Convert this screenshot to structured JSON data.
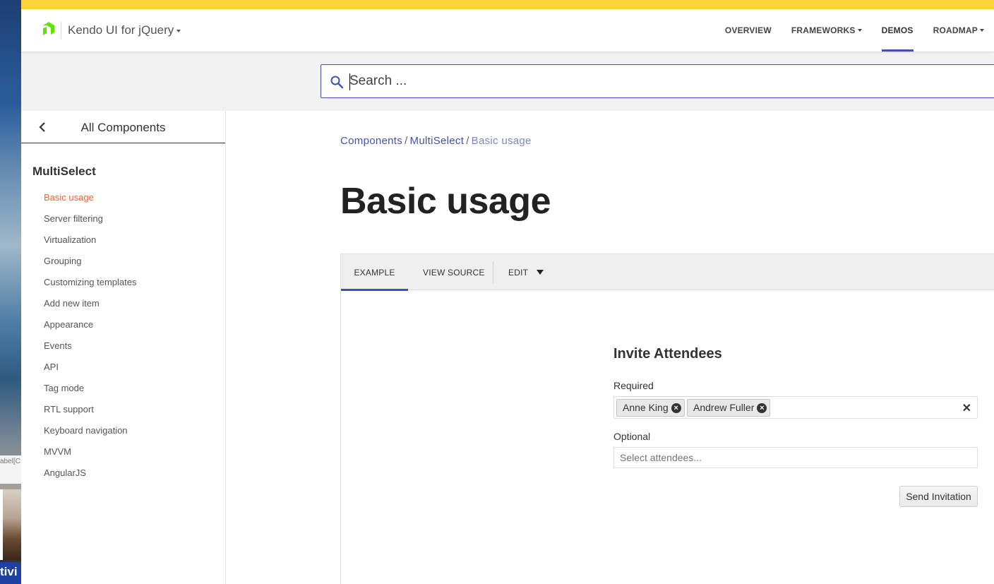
{
  "background": {
    "label_fragment": "abel[C",
    "activity_fragment": "tivi"
  },
  "header": {
    "product": "Kendo UI for jQuery",
    "nav": [
      {
        "label": "OVERVIEW"
      },
      {
        "label": "FRAMEWORKS"
      },
      {
        "label": "DEMOS"
      },
      {
        "label": "ROADMAP"
      }
    ]
  },
  "search": {
    "placeholder": "Search ..."
  },
  "sidebar": {
    "title": "All Components",
    "group": "MultiSelect",
    "items": [
      {
        "label": "Basic usage"
      },
      {
        "label": "Server filtering"
      },
      {
        "label": "Virtualization"
      },
      {
        "label": "Grouping"
      },
      {
        "label": "Customizing templates"
      },
      {
        "label": "Add new item"
      },
      {
        "label": "Appearance"
      },
      {
        "label": "Events"
      },
      {
        "label": "API"
      },
      {
        "label": "Tag mode"
      },
      {
        "label": "RTL support"
      },
      {
        "label": "Keyboard navigation"
      },
      {
        "label": "MVVM"
      },
      {
        "label": "AngularJS"
      }
    ]
  },
  "breadcrumb": {
    "items": [
      "Components",
      "MultiSelect"
    ],
    "current": "Basic usage",
    "separator": "/"
  },
  "page": {
    "title": "Basic usage"
  },
  "demo": {
    "tabs": [
      {
        "label": "EXAMPLE"
      },
      {
        "label": "VIEW SOURCE"
      },
      {
        "label": "EDIT"
      }
    ],
    "form": {
      "title": "Invite Attendees",
      "required_label": "Required",
      "required_tags": [
        "Anne King",
        "Andrew Fuller"
      ],
      "optional_label": "Optional",
      "optional_placeholder": "Select attendees...",
      "send_label": "Send Invitation"
    }
  },
  "colors": {
    "topbar": "#fdd43a",
    "accent": "#3f51b5",
    "active_link": "#f0622f"
  }
}
